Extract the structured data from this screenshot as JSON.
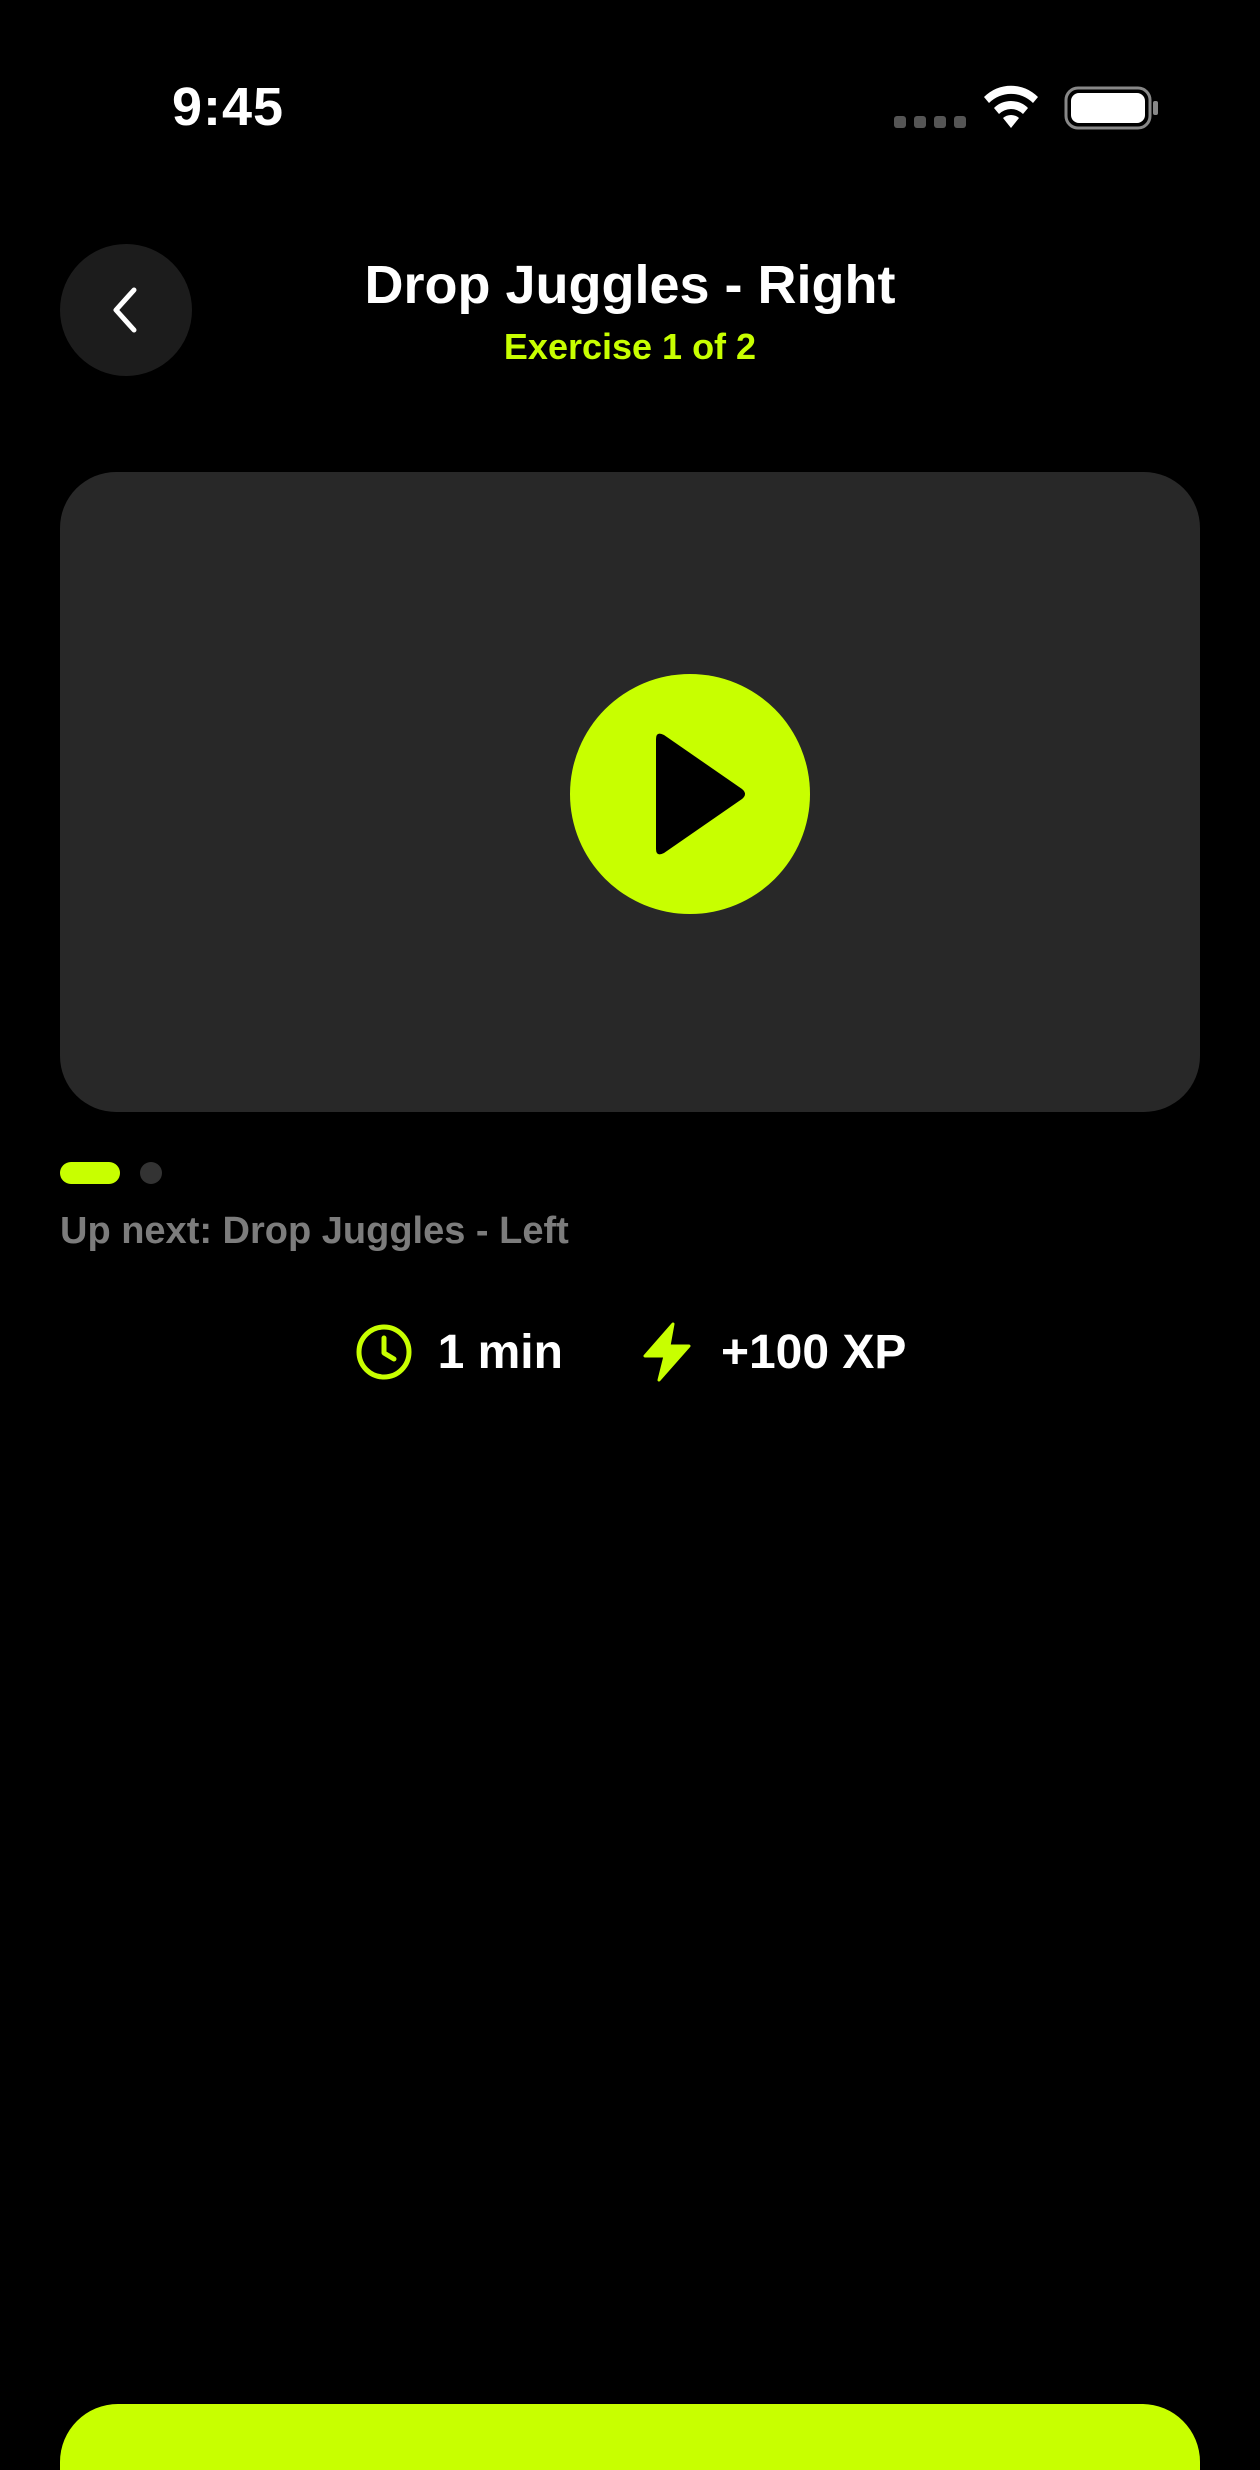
{
  "status_bar": {
    "time": "9:45"
  },
  "header": {
    "title": "Drop Juggles - Right",
    "subtitle": "Exercise 1 of 2",
    "back_icon": "chevron-left-icon"
  },
  "video": {
    "play_icon": "play-icon",
    "card_color": "#282828"
  },
  "pager": {
    "total": 2,
    "current": 1
  },
  "up_next": "Up next: Drop Juggles - Left",
  "stats": {
    "duration": "1 min",
    "duration_icon": "clock-icon",
    "xp": "+100 XP",
    "xp_icon": "lightning-bolt-icon"
  },
  "colors": {
    "accent": "#c8ff00",
    "background": "#000000",
    "muted_text": "#7c7c7c"
  }
}
